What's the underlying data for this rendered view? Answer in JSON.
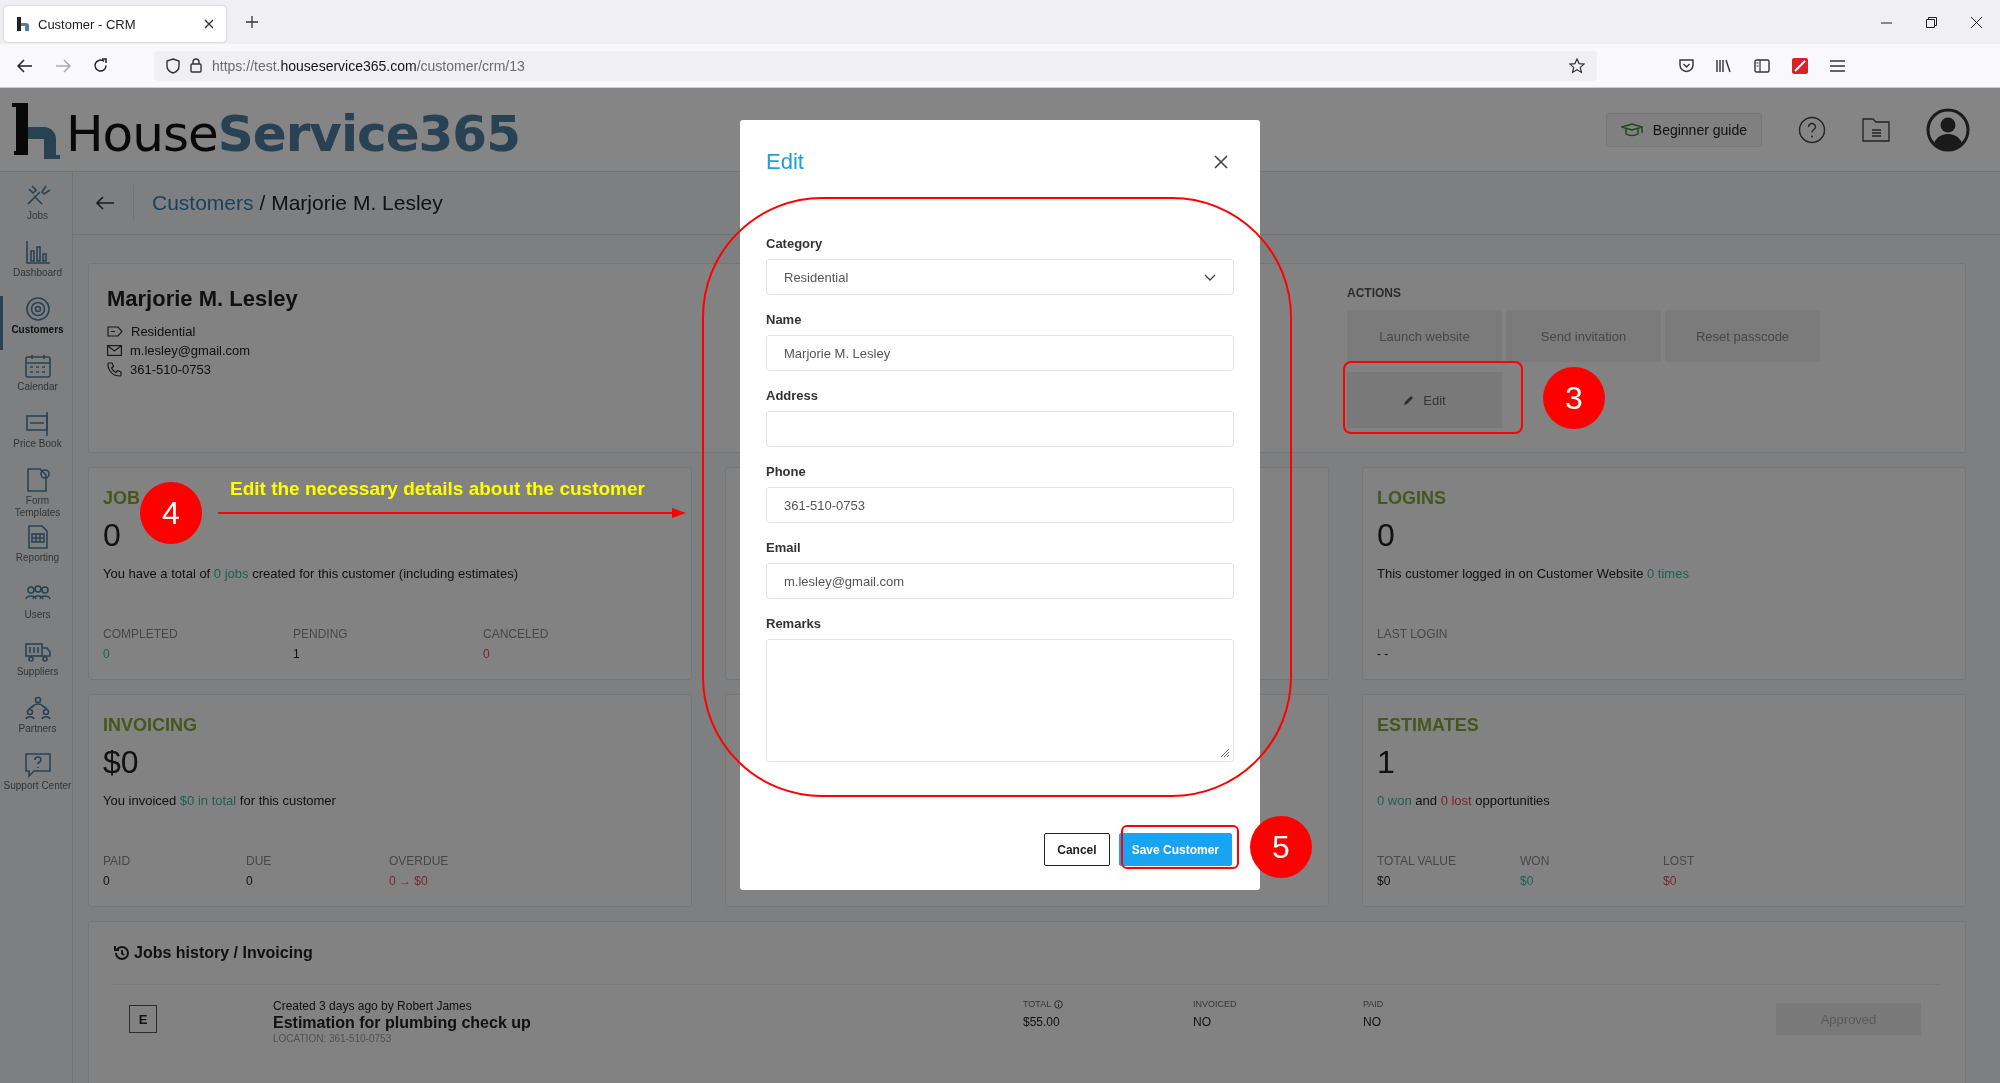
{
  "browser": {
    "tab_title": "Customer - CRM",
    "url_prefix": "https://test.",
    "url_domain": "houseservice365.com",
    "url_path": "/customer/crm/13",
    "forward_disabled": true
  },
  "logo": {
    "part_1": "House",
    "part_2": "Service365"
  },
  "header": {
    "guide_button": "Beginner guide"
  },
  "sidebar": {
    "items": [
      {
        "label": "Jobs",
        "kind": "tools",
        "selected": false
      },
      {
        "label": "Dashboard",
        "kind": "chart",
        "selected": false
      },
      {
        "label": "Customers",
        "kind": "target",
        "selected": true
      },
      {
        "label": "Calendar",
        "kind": "calendar",
        "selected": false
      },
      {
        "label": "Price Book",
        "kind": "price",
        "selected": false
      },
      {
        "label": "Form Templates",
        "kind": "form",
        "selected": false
      },
      {
        "label": "Reporting",
        "kind": "report",
        "selected": false
      },
      {
        "label": "Users",
        "kind": "users",
        "selected": false
      },
      {
        "label": "Suppliers",
        "kind": "truck",
        "selected": false
      },
      {
        "label": "Partners",
        "kind": "partners",
        "selected": false
      },
      {
        "label": "Support Center",
        "kind": "support",
        "selected": false
      }
    ]
  },
  "breadcrumb": {
    "link": "Customers",
    "separator": "/",
    "current": "Marjorie M. Lesley"
  },
  "customer": {
    "name": "Marjorie M. Lesley",
    "category": "Residential",
    "email": "m.lesley@gmail.com",
    "phone": "361-510-0753"
  },
  "actions": {
    "title": "ACTIONS",
    "buttons": [
      {
        "label": "Launch website",
        "kind": "plain"
      },
      {
        "label": "Send invitation",
        "kind": "plain"
      },
      {
        "label": "Reset passcode",
        "kind": "plain"
      },
      {
        "label": "Edit",
        "kind": "edit"
      }
    ]
  },
  "card_rows": [
    [
      {
        "title": "JOB",
        "value": "0",
        "description": [
          {
            "text": "You have a total of ",
            "kind": "plain"
          },
          {
            "text": "0 jobs",
            "kind": "positive"
          },
          {
            "text": " created for this customer (including estimates)",
            "kind": "plain"
          }
        ],
        "stats": [
          {
            "label": "COMPLETED",
            "value": "0",
            "kind": "positive"
          },
          {
            "label": "PENDING",
            "value": "1",
            "kind": "plain"
          },
          {
            "label": "CANCELED",
            "value": "0",
            "kind": "negative"
          }
        ]
      },
      {
        "title": "LOGINS",
        "value": "0",
        "description": [
          {
            "text": "This customer logged in on Customer Website ",
            "kind": "plain"
          },
          {
            "text": "0 times",
            "kind": "positive"
          }
        ],
        "stats": [
          {
            "label": "LAST LOGIN",
            "value": "- -",
            "kind": "plain"
          }
        ]
      }
    ],
    [
      {
        "title": "INVOICING",
        "value": "$0",
        "description": [
          {
            "text": "You invoiced ",
            "kind": "plain"
          },
          {
            "text": "$0 in total",
            "kind": "positive"
          },
          {
            "text": " for this customer",
            "kind": "plain"
          }
        ],
        "stats": [
          {
            "label": "PAID",
            "value": "0",
            "kind": "plain"
          },
          {
            "label": "DUE",
            "value": "0",
            "kind": "plain"
          },
          {
            "label": "OVERDUE",
            "value": "0 → $0",
            "kind": "negative"
          }
        ]
      },
      {
        "title": "ESTIMATES",
        "value": "1",
        "description": [
          {
            "text": "0 won",
            "kind": "positive"
          },
          {
            "text": " and ",
            "kind": "plain"
          },
          {
            "text": "0 lost",
            "kind": "negative"
          },
          {
            "text": " opportunities",
            "kind": "plain"
          }
        ],
        "stats": [
          {
            "label": "TOTAL VALUE",
            "value": "$0",
            "kind": "plain"
          },
          {
            "label": "WON",
            "value": "$0",
            "kind": "positive"
          },
          {
            "label": "LOST",
            "value": "$0",
            "kind": "negative"
          }
        ]
      }
    ]
  ],
  "history": {
    "title": "Jobs history / Invoicing",
    "rows": [
      {
        "badge": "E",
        "created": "Created 3 days ago by Robert James",
        "title": "Estimation for plumbing check up",
        "location": "LOCATION: 361-510-0753",
        "columns": [
          {
            "label": "TOTAL",
            "value": "$55.00",
            "info": true
          },
          {
            "label": "INVOICED",
            "value": "NO",
            "info": false
          },
          {
            "label": "PAID",
            "value": "NO",
            "info": false
          }
        ],
        "status": "Approved"
      }
    ]
  },
  "modal": {
    "title": "Edit",
    "fields": [
      {
        "label": "Category",
        "kind": "select",
        "value": "Residential"
      },
      {
        "label": "Name",
        "kind": "text",
        "value": "Marjorie M. Lesley"
      },
      {
        "label": "Address",
        "kind": "text"
      },
      {
        "label": "Phone",
        "kind": "text",
        "value": "361-510-0753"
      },
      {
        "label": "Email",
        "kind": "text",
        "value": "m.lesley@gmail.com"
      },
      {
        "label": "Remarks",
        "kind": "textarea"
      }
    ],
    "buttons": [
      {
        "label": "Cancel",
        "kind": "secondary"
      },
      {
        "label": "Save Customer",
        "kind": "primary"
      }
    ]
  },
  "annotations": {
    "badges": [
      "3",
      "4",
      "5"
    ],
    "note": "Edit the necessary details about the customer"
  }
}
